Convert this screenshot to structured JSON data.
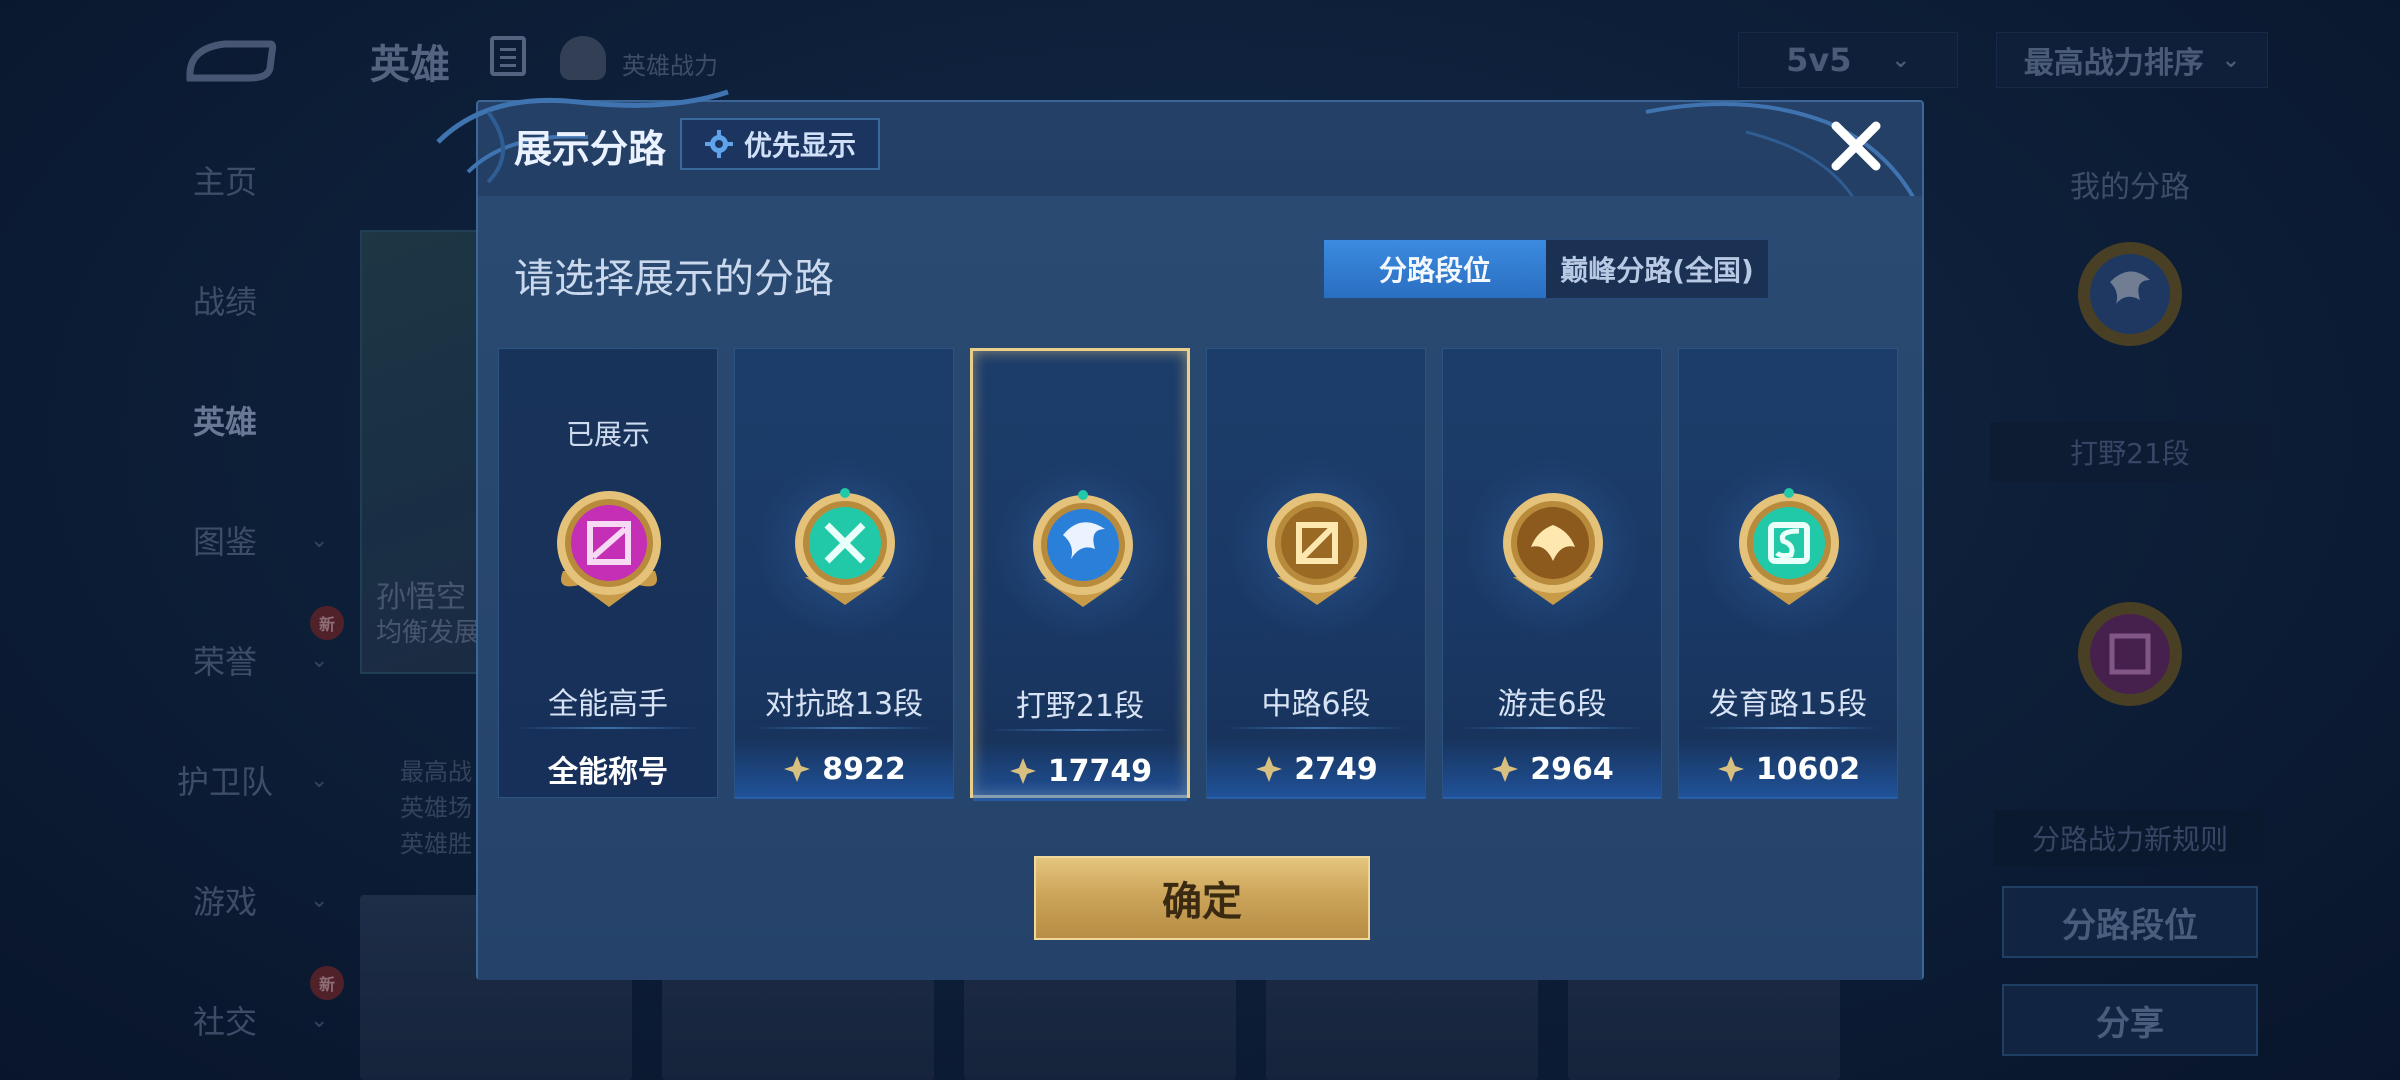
{
  "background": {
    "top_bar": {
      "title": "英雄",
      "power_label": "英雄战力",
      "mode_select": "5v5",
      "sort_select": "最高战力排序"
    },
    "nav": [
      {
        "label": "主页",
        "active": false,
        "chevron": false,
        "badge": ""
      },
      {
        "label": "战绩",
        "active": false,
        "chevron": false,
        "badge": ""
      },
      {
        "label": "英雄",
        "active": true,
        "chevron": false,
        "badge": ""
      },
      {
        "label": "图鉴",
        "active": false,
        "chevron": true,
        "badge": ""
      },
      {
        "label": "荣誉",
        "active": false,
        "chevron": true,
        "badge": "新"
      },
      {
        "label": "护卫队",
        "active": false,
        "chevron": true,
        "badge": ""
      },
      {
        "label": "游戏",
        "active": false,
        "chevron": true,
        "badge": ""
      },
      {
        "label": "社交",
        "active": false,
        "chevron": true,
        "badge": "新"
      }
    ],
    "hero_card": {
      "name": "孙悟空",
      "sub": "均衡发展"
    },
    "hero_info_lines": [
      "最高战",
      "英雄场",
      "英雄胜"
    ],
    "right_panel": {
      "title": "我的分路",
      "lane_label": "打野21段",
      "rule_label": "分路战力新规则",
      "btn_lane": "分路段位",
      "btn_share": "分享"
    }
  },
  "dialog": {
    "title": "展示分路",
    "priority_button": "优先显示",
    "prompt": "请选择展示的分路",
    "tabs": [
      {
        "label": "分路段位",
        "active": true
      },
      {
        "label": "巅峰分路(全国)",
        "active": false
      }
    ],
    "lanes": [
      {
        "shown_label": "已展示",
        "name": "全能高手",
        "power": "全能称号",
        "emblem": "allround-emblem-icon",
        "color": "#c42fb5",
        "selected": false,
        "shown": true
      },
      {
        "shown_label": "",
        "name": "对抗路13段",
        "power": "8922",
        "emblem": "clash-lane-emblem-icon",
        "color": "#21c9a8",
        "selected": false,
        "shown": false
      },
      {
        "shown_label": "",
        "name": "打野21段",
        "power": "17749",
        "emblem": "jungle-emblem-icon",
        "color": "#2a7fd8",
        "selected": true,
        "shown": false
      },
      {
        "shown_label": "",
        "name": "中路6段",
        "power": "2749",
        "emblem": "mid-lane-emblem-icon",
        "color": "#c8912e",
        "selected": false,
        "shown": false
      },
      {
        "shown_label": "",
        "name": "游走6段",
        "power": "2964",
        "emblem": "roam-emblem-icon",
        "color": "#c8912e",
        "selected": false,
        "shown": false
      },
      {
        "shown_label": "",
        "name": "发育路15段",
        "power": "10602",
        "emblem": "farm-lane-emblem-icon",
        "color": "#21c9a8",
        "selected": false,
        "shown": false
      }
    ],
    "confirm_button": "确定"
  },
  "colors": {
    "accent_blue": "#3b8be0",
    "gold": "#caa258",
    "selected_border": "#e9cf8a"
  }
}
